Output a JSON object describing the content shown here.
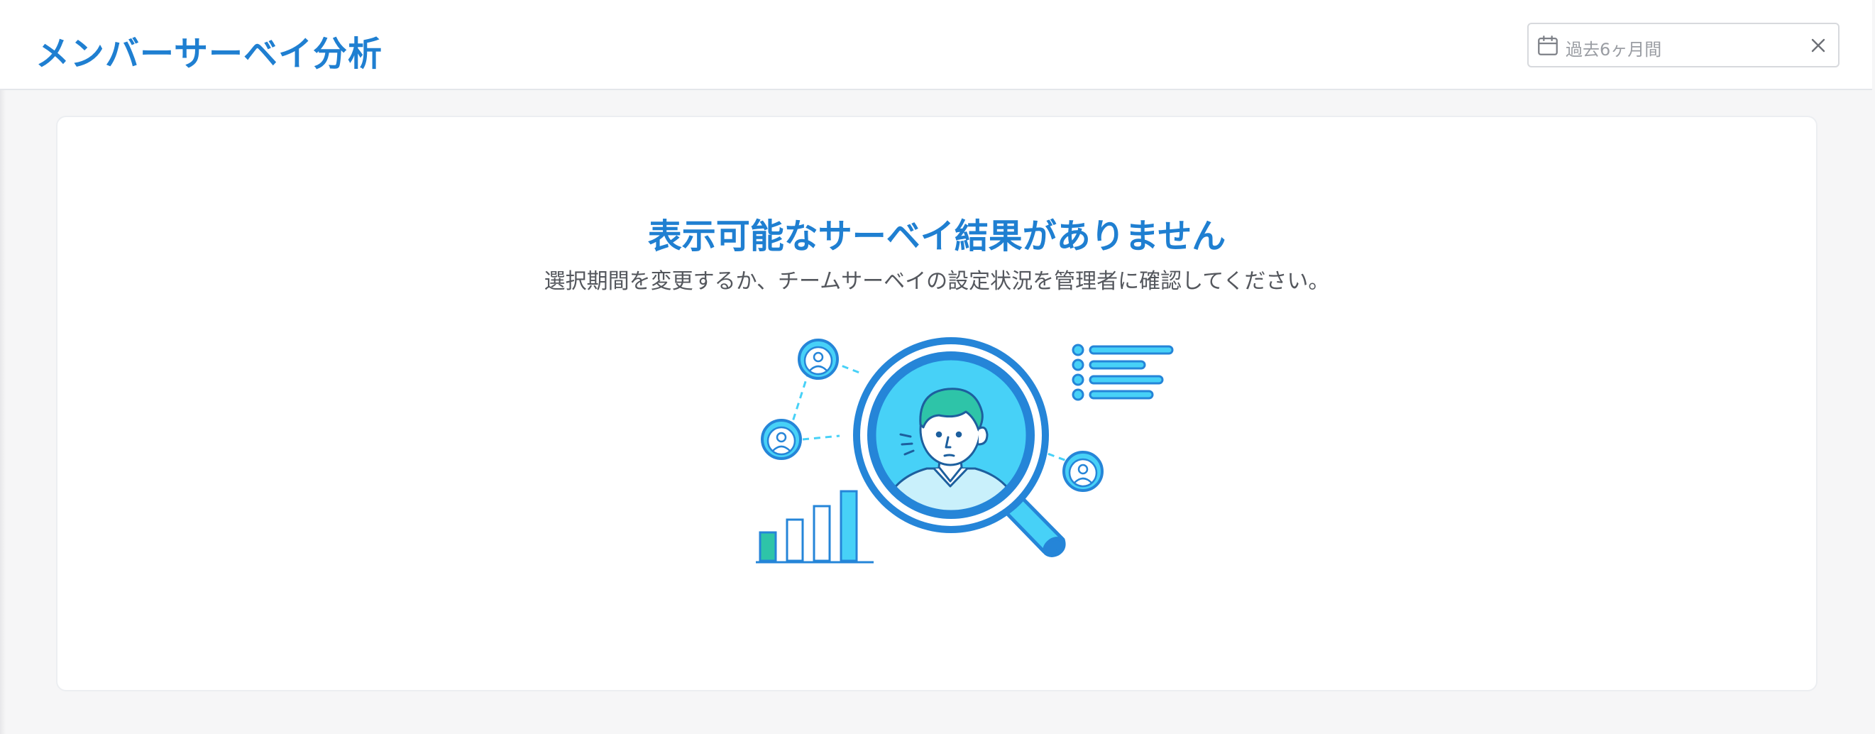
{
  "header": {
    "title": "メンバーサーベイ分析"
  },
  "date_filter": {
    "placeholder": "過去6ヶ月間",
    "calendar_icon": "calendar-icon",
    "clear_icon": "close-icon"
  },
  "empty_state": {
    "title": "表示可能なサーベイ結果がありません",
    "message": "選択期間を変更するか、チームサーベイの設定状況を管理者に確認してください。",
    "illustration": "magnifier-person-analytics-illustration"
  },
  "colors": {
    "accent": "#1f7fd1",
    "light_blue": "#47d1f7",
    "outline": "#2585d8",
    "teal": "#2ec4a8",
    "background": "#f6f6f7"
  }
}
